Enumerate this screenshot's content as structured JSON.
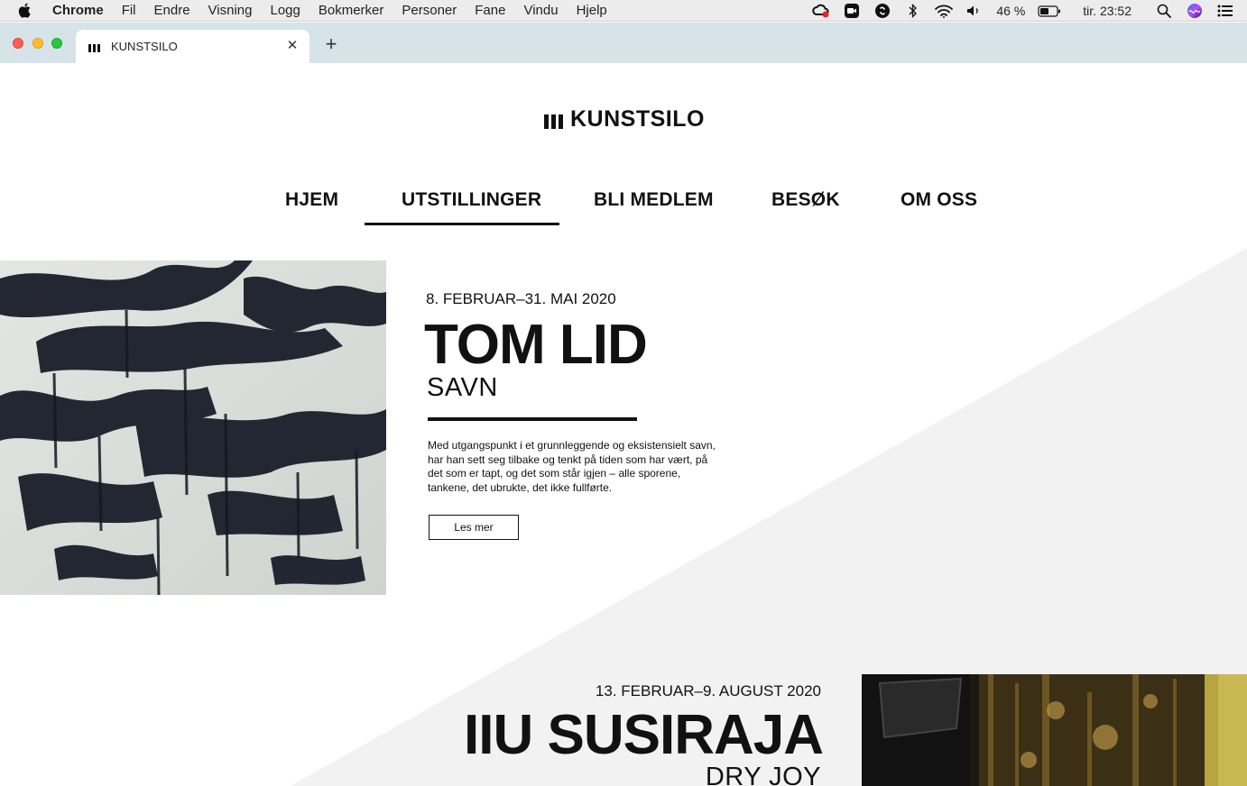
{
  "menubar": {
    "app": "Chrome",
    "items": [
      "Fil",
      "Endre",
      "Visning",
      "Logg",
      "Bokmerker",
      "Personer",
      "Fane",
      "Vindu",
      "Hjelp"
    ],
    "battery": "46 %",
    "clock": "tir. 23:52"
  },
  "browser": {
    "tab_title": "KUNSTSILO",
    "close_glyph": "✕",
    "new_tab_glyph": "+"
  },
  "site": {
    "logo": "KUNSTSILO",
    "nav": [
      "HJEM",
      "UTSTILLINGER",
      "BLI MEDLEM",
      "BESØK",
      "OM OSS"
    ],
    "active_nav": "UTSTILLINGER"
  },
  "exhibitions": [
    {
      "date": "8. FEBRUAR–31. MAI 2020",
      "artist": "TOM LID",
      "title": "SAVN",
      "description": "Med utgangspunkt i et grunnleggende og eksistensielt savn, har han sett seg tilbake og tenkt på tiden som har vært, på det som er tapt, og det som står igjen – alle sporene, tankene, det ubrukte, det ikke fullførte.",
      "button": "Les mer"
    },
    {
      "date": "13. FEBRUAR–9. AUGUST 2020",
      "artist": "IIU SUSIRAJA",
      "title": "DRY JOY"
    }
  ],
  "colors": {
    "accent": "#111111",
    "diagonal_band": "#f2f2f2",
    "tabstrip": "#d6e3e8"
  }
}
